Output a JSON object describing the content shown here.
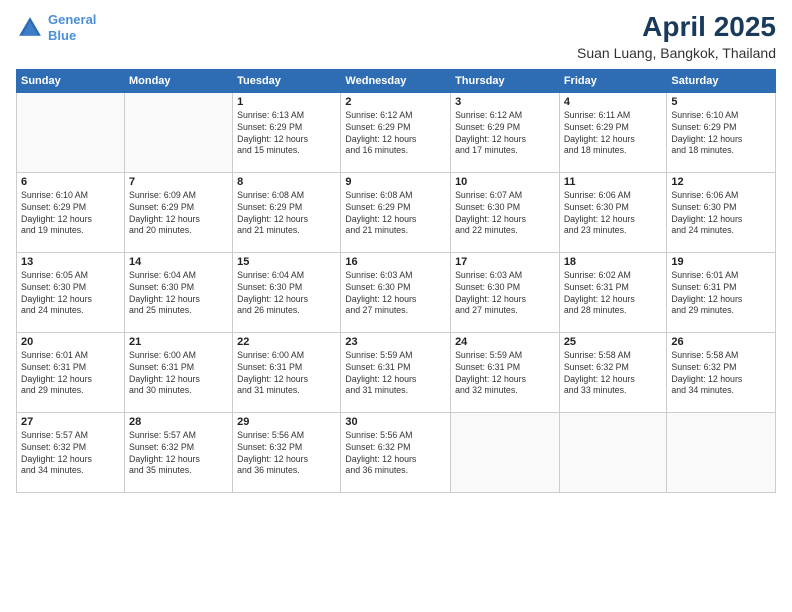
{
  "header": {
    "logo_line1": "General",
    "logo_line2": "Blue",
    "title": "April 2025",
    "subtitle": "Suan Luang, Bangkok, Thailand"
  },
  "calendar": {
    "days_of_week": [
      "Sunday",
      "Monday",
      "Tuesday",
      "Wednesday",
      "Thursday",
      "Friday",
      "Saturday"
    ],
    "weeks": [
      [
        {
          "num": "",
          "detail": ""
        },
        {
          "num": "",
          "detail": ""
        },
        {
          "num": "1",
          "detail": "Sunrise: 6:13 AM\nSunset: 6:29 PM\nDaylight: 12 hours\nand 15 minutes."
        },
        {
          "num": "2",
          "detail": "Sunrise: 6:12 AM\nSunset: 6:29 PM\nDaylight: 12 hours\nand 16 minutes."
        },
        {
          "num": "3",
          "detail": "Sunrise: 6:12 AM\nSunset: 6:29 PM\nDaylight: 12 hours\nand 17 minutes."
        },
        {
          "num": "4",
          "detail": "Sunrise: 6:11 AM\nSunset: 6:29 PM\nDaylight: 12 hours\nand 18 minutes."
        },
        {
          "num": "5",
          "detail": "Sunrise: 6:10 AM\nSunset: 6:29 PM\nDaylight: 12 hours\nand 18 minutes."
        }
      ],
      [
        {
          "num": "6",
          "detail": "Sunrise: 6:10 AM\nSunset: 6:29 PM\nDaylight: 12 hours\nand 19 minutes."
        },
        {
          "num": "7",
          "detail": "Sunrise: 6:09 AM\nSunset: 6:29 PM\nDaylight: 12 hours\nand 20 minutes."
        },
        {
          "num": "8",
          "detail": "Sunrise: 6:08 AM\nSunset: 6:29 PM\nDaylight: 12 hours\nand 21 minutes."
        },
        {
          "num": "9",
          "detail": "Sunrise: 6:08 AM\nSunset: 6:29 PM\nDaylight: 12 hours\nand 21 minutes."
        },
        {
          "num": "10",
          "detail": "Sunrise: 6:07 AM\nSunset: 6:30 PM\nDaylight: 12 hours\nand 22 minutes."
        },
        {
          "num": "11",
          "detail": "Sunrise: 6:06 AM\nSunset: 6:30 PM\nDaylight: 12 hours\nand 23 minutes."
        },
        {
          "num": "12",
          "detail": "Sunrise: 6:06 AM\nSunset: 6:30 PM\nDaylight: 12 hours\nand 24 minutes."
        }
      ],
      [
        {
          "num": "13",
          "detail": "Sunrise: 6:05 AM\nSunset: 6:30 PM\nDaylight: 12 hours\nand 24 minutes."
        },
        {
          "num": "14",
          "detail": "Sunrise: 6:04 AM\nSunset: 6:30 PM\nDaylight: 12 hours\nand 25 minutes."
        },
        {
          "num": "15",
          "detail": "Sunrise: 6:04 AM\nSunset: 6:30 PM\nDaylight: 12 hours\nand 26 minutes."
        },
        {
          "num": "16",
          "detail": "Sunrise: 6:03 AM\nSunset: 6:30 PM\nDaylight: 12 hours\nand 27 minutes."
        },
        {
          "num": "17",
          "detail": "Sunrise: 6:03 AM\nSunset: 6:30 PM\nDaylight: 12 hours\nand 27 minutes."
        },
        {
          "num": "18",
          "detail": "Sunrise: 6:02 AM\nSunset: 6:31 PM\nDaylight: 12 hours\nand 28 minutes."
        },
        {
          "num": "19",
          "detail": "Sunrise: 6:01 AM\nSunset: 6:31 PM\nDaylight: 12 hours\nand 29 minutes."
        }
      ],
      [
        {
          "num": "20",
          "detail": "Sunrise: 6:01 AM\nSunset: 6:31 PM\nDaylight: 12 hours\nand 29 minutes."
        },
        {
          "num": "21",
          "detail": "Sunrise: 6:00 AM\nSunset: 6:31 PM\nDaylight: 12 hours\nand 30 minutes."
        },
        {
          "num": "22",
          "detail": "Sunrise: 6:00 AM\nSunset: 6:31 PM\nDaylight: 12 hours\nand 31 minutes."
        },
        {
          "num": "23",
          "detail": "Sunrise: 5:59 AM\nSunset: 6:31 PM\nDaylight: 12 hours\nand 31 minutes."
        },
        {
          "num": "24",
          "detail": "Sunrise: 5:59 AM\nSunset: 6:31 PM\nDaylight: 12 hours\nand 32 minutes."
        },
        {
          "num": "25",
          "detail": "Sunrise: 5:58 AM\nSunset: 6:32 PM\nDaylight: 12 hours\nand 33 minutes."
        },
        {
          "num": "26",
          "detail": "Sunrise: 5:58 AM\nSunset: 6:32 PM\nDaylight: 12 hours\nand 34 minutes."
        }
      ],
      [
        {
          "num": "27",
          "detail": "Sunrise: 5:57 AM\nSunset: 6:32 PM\nDaylight: 12 hours\nand 34 minutes."
        },
        {
          "num": "28",
          "detail": "Sunrise: 5:57 AM\nSunset: 6:32 PM\nDaylight: 12 hours\nand 35 minutes."
        },
        {
          "num": "29",
          "detail": "Sunrise: 5:56 AM\nSunset: 6:32 PM\nDaylight: 12 hours\nand 36 minutes."
        },
        {
          "num": "30",
          "detail": "Sunrise: 5:56 AM\nSunset: 6:32 PM\nDaylight: 12 hours\nand 36 minutes."
        },
        {
          "num": "",
          "detail": ""
        },
        {
          "num": "",
          "detail": ""
        },
        {
          "num": "",
          "detail": ""
        }
      ]
    ]
  }
}
